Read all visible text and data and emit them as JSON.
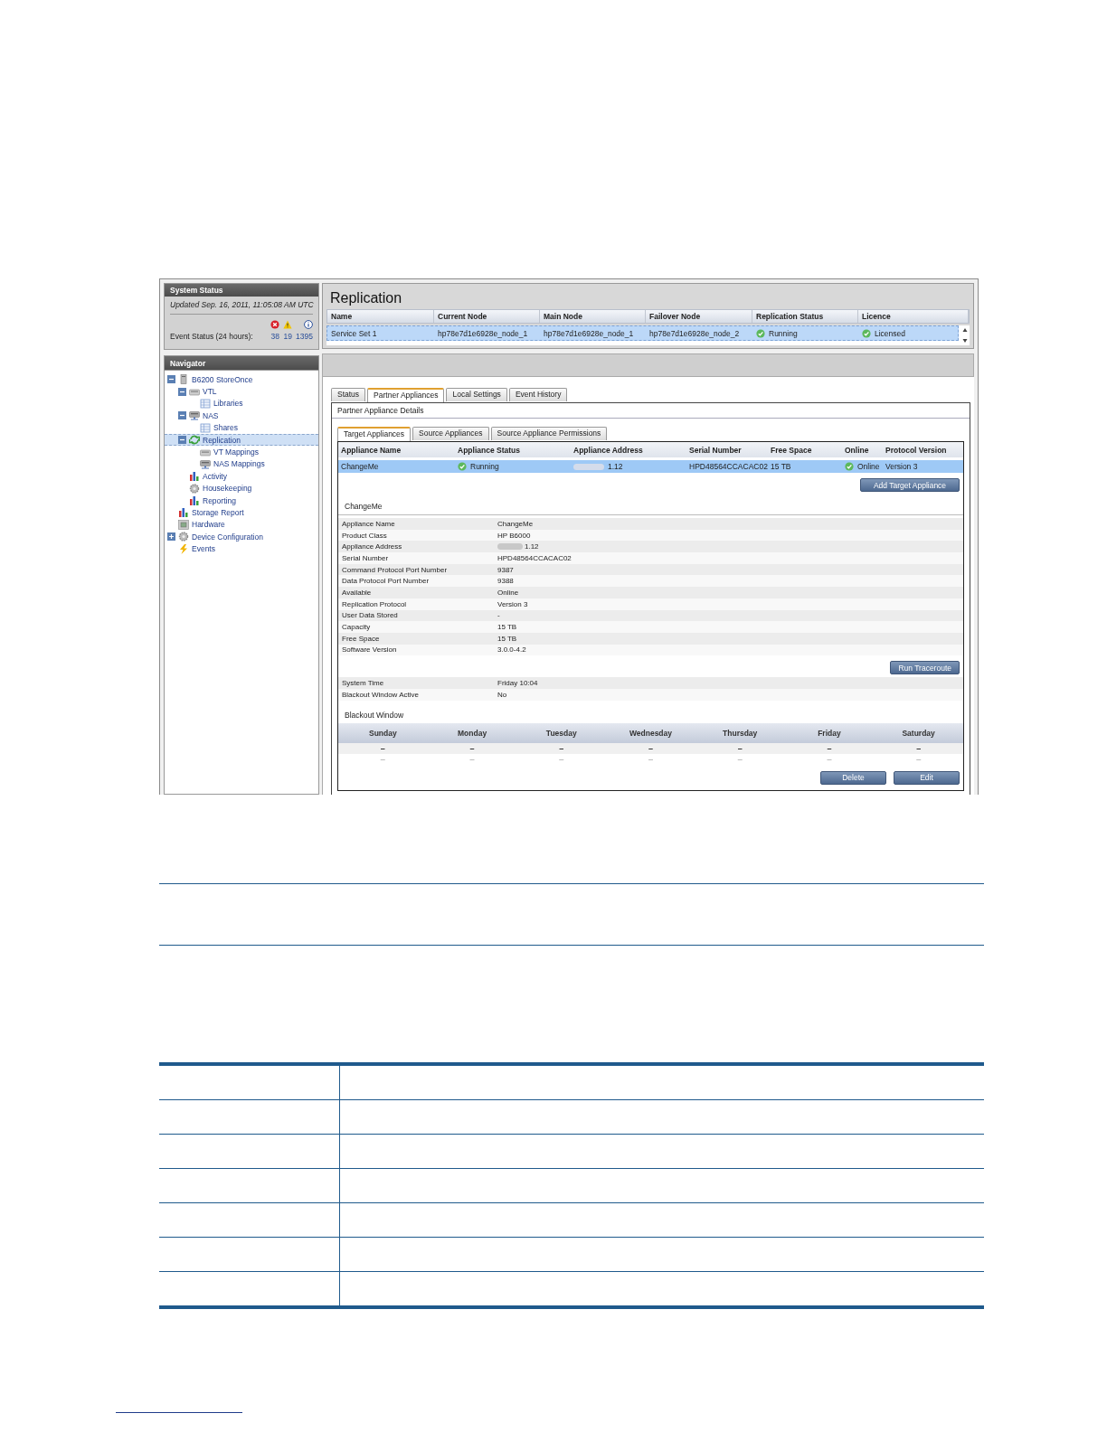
{
  "system_status": {
    "title": "System Status",
    "updated": "Updated Sep. 16, 2011, 11:05:08 AM UTC",
    "event_label": "Event Status (24 hours):",
    "counts": [
      {
        "kind": "error",
        "value": "38"
      },
      {
        "kind": "warning",
        "value": "19"
      },
      {
        "kind": "info",
        "value": "1395"
      }
    ]
  },
  "navigator": {
    "title": "Navigator",
    "items": [
      {
        "label": "B6200 StoreOnce",
        "kind": "server",
        "expanded": true,
        "selected": false,
        "children": [
          {
            "label": "VTL",
            "kind": "tape",
            "expanded": true,
            "selected": false,
            "children": [
              {
                "label": "Libraries",
                "kind": "table",
                "selected": false
              }
            ]
          },
          {
            "label": "NAS",
            "kind": "nas",
            "expanded": true,
            "selected": false,
            "children": [
              {
                "label": "Shares",
                "kind": "table",
                "selected": false
              }
            ]
          },
          {
            "label": "Replication",
            "kind": "replication",
            "expanded": true,
            "selected": true,
            "children": [
              {
                "label": "VT Mappings",
                "kind": "tape",
                "selected": false
              },
              {
                "label": "NAS Mappings",
                "kind": "nas",
                "selected": false
              }
            ]
          },
          {
            "label": "Activity",
            "kind": "chart",
            "selected": false
          },
          {
            "label": "Housekeeping",
            "kind": "gear",
            "selected": false
          },
          {
            "label": "Reporting",
            "kind": "chart",
            "selected": false
          }
        ]
      },
      {
        "label": "Storage Report",
        "kind": "chart",
        "selected": false
      },
      {
        "label": "Hardware",
        "kind": "hardware",
        "selected": false
      },
      {
        "label": "Device Configuration",
        "kind": "gear",
        "expanded": false,
        "selected": false
      },
      {
        "label": "Events",
        "kind": "events",
        "selected": false
      }
    ]
  },
  "replication": {
    "title": "Replication",
    "columns": [
      "Name",
      "Current Node",
      "Main Node",
      "Failover Node",
      "Replication Status",
      "Licence"
    ],
    "rows": [
      {
        "selected": true,
        "cells": [
          "Service Set 1",
          "hp78e7d1e6928e_node_1",
          "hp78e7d1e6928e_node_1",
          "hp78e7d1e6928e_node_2"
        ],
        "status": "Running",
        "licence": "Licensed"
      }
    ]
  },
  "tabs": [
    {
      "label": "Status",
      "selected": false
    },
    {
      "label": "Partner Appliances",
      "selected": true
    },
    {
      "label": "Local Settings",
      "selected": false
    },
    {
      "label": "Event History",
      "selected": false
    }
  ],
  "panel_title": "Partner Appliance Details",
  "subtabs": [
    {
      "label": "Target Appliances",
      "selected": true
    },
    {
      "label": "Source Appliances",
      "selected": false
    },
    {
      "label": "Source Appliance Permissions",
      "selected": false
    }
  ],
  "appliances": {
    "columns": [
      "Appliance Name",
      "Appliance Status",
      "Appliance Address",
      "Serial Number",
      "Free Space",
      "Online",
      "Protocol Version"
    ],
    "rows": [
      {
        "selected": true,
        "name": "ChangeMe",
        "status": "Running",
        "address": "1.12",
        "serial": "HPD48564CCACAC02",
        "free": "15 TB",
        "online": "Online",
        "protocol": "Version 3"
      }
    ]
  },
  "add_button": "Add Target Appliance",
  "detail_title": "ChangeMe",
  "details": [
    {
      "label": "Appliance Name",
      "value": "ChangeMe"
    },
    {
      "label": "Product Class",
      "value": "HP B6000"
    },
    {
      "label": "Appliance Address",
      "value": "1.12",
      "redacted": true
    },
    {
      "label": "Serial Number",
      "value": "HPD48564CCACAC02"
    },
    {
      "label": "Command Protocol Port Number",
      "value": "9387"
    },
    {
      "label": "Data Protocol Port Number",
      "value": "9388"
    },
    {
      "label": "Available",
      "value": "Online"
    },
    {
      "label": "Replication Protocol",
      "value": "Version 3"
    },
    {
      "label": "User Data Stored",
      "value": "-"
    },
    {
      "label": "Capacity",
      "value": "15 TB"
    },
    {
      "label": "Free Space",
      "value": "15 TB"
    },
    {
      "label": "Software Version",
      "value": "3.0.0-4.2"
    }
  ],
  "traceroute_button": "Run Traceroute",
  "time_details": [
    {
      "label": "System Time",
      "value": "Friday 10:04"
    },
    {
      "label": "Blackout Window Active",
      "value": "No"
    }
  ],
  "blackout": {
    "title": "Blackout Window",
    "days": [
      "Sunday",
      "Monday",
      "Tuesday",
      "Wednesday",
      "Thursday",
      "Friday",
      "Saturday"
    ],
    "rows": [
      {
        "bold": true,
        "cells": [
          "–",
          "–",
          "–",
          "–",
          "–",
          "–",
          "–"
        ]
      },
      {
        "bold": false,
        "cells": [
          "–",
          "–",
          "–",
          "–",
          "–",
          "–",
          "–"
        ]
      }
    ]
  },
  "buttons": [
    "Delete",
    "Edit"
  ]
}
